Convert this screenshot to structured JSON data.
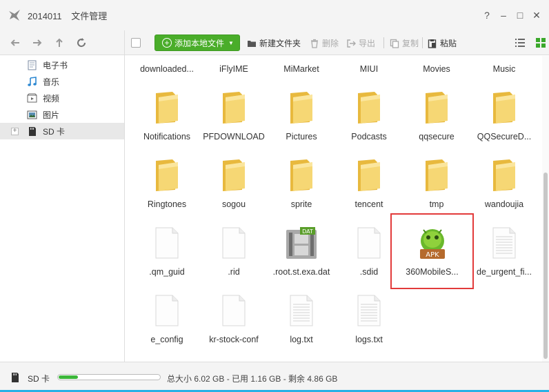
{
  "window": {
    "title_id": "2014011",
    "title_name": "文件管理",
    "controls": [
      "?",
      "–",
      "□",
      "✕"
    ]
  },
  "toolbar": {
    "add_label": "添加本地文件",
    "new_folder": "新建文件夹",
    "delete": "删除",
    "export": "导出",
    "copy": "复制",
    "paste": "粘贴"
  },
  "sidebar": {
    "items": [
      {
        "label": "电子书",
        "icon": "ebook-icon"
      },
      {
        "label": "音乐",
        "icon": "music-icon"
      },
      {
        "label": "视频",
        "icon": "video-icon"
      },
      {
        "label": "图片",
        "icon": "picture-icon"
      },
      {
        "label": "SD 卡",
        "icon": "sd-card-icon"
      }
    ],
    "expand_symbol": "+"
  },
  "files": {
    "row0": [
      "downloaded...",
      "iFlyIME",
      "MiMarket",
      "MIUI",
      "Movies",
      "Music"
    ],
    "row1": [
      "Notifications",
      "PFDOWNLOAD",
      "Pictures",
      "Podcasts",
      "qqsecure",
      "QQSecureD..."
    ],
    "row2": [
      "Ringtones",
      "sogou",
      "sprite",
      "tencent",
      "tmp",
      "wandoujia"
    ],
    "row3": [
      ".qm_guid",
      ".rid",
      ".root.st.exa.dat",
      ".sdid",
      "360MobileS...",
      "de_urgent_fi..."
    ],
    "row4": [
      "e_config",
      "kr-stock-conf",
      "log.txt",
      "logs.txt"
    ],
    "badges": {
      "dat": "DAT",
      "apk": "APK"
    }
  },
  "status": {
    "device": "SD 卡",
    "storage_text": "总大小 6.02 GB - 已用 1.16 GB - 剩余 4.86 GB",
    "used_fraction": 0.193
  },
  "colors": {
    "accent_green": "#4aad2a",
    "folder_yellow": "#f2cf59",
    "highlight_red": "#e23a3a",
    "bottom_bar": "#25b1e6"
  }
}
